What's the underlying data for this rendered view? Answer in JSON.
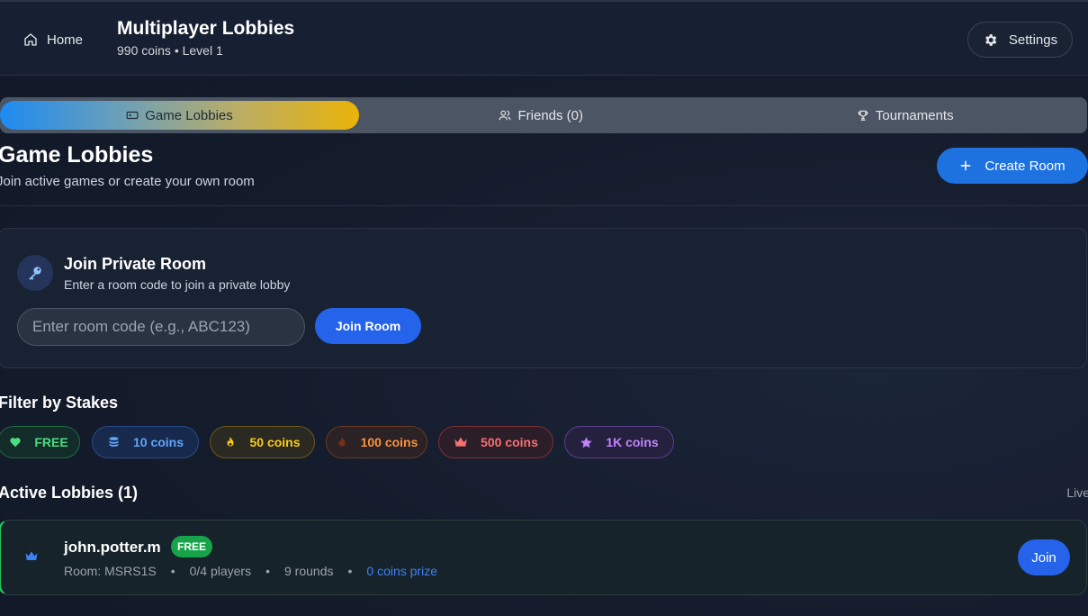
{
  "header": {
    "home_label": "Home",
    "title": "Multiplayer Lobbies",
    "subtitle": "990 coins • Level 1",
    "settings_label": "Settings"
  },
  "tabs": [
    {
      "label": "Game Lobbies",
      "icon": "gamepad-icon",
      "active": true
    },
    {
      "label": "Friends (0)",
      "icon": "users-icon",
      "active": false
    },
    {
      "label": "Tournaments",
      "icon": "trophy-icon",
      "active": false
    }
  ],
  "section": {
    "title": "Game Lobbies",
    "subtitle": "Join active games or create your own room",
    "create_label": "Create Room"
  },
  "private_room": {
    "title": "Join Private Room",
    "subtitle": "Enter a room code to join a private lobby",
    "input_placeholder": "Enter room code (e.g., ABC123)",
    "input_value": "",
    "join_label": "Join Room"
  },
  "filters": {
    "title": "Filter by Stakes",
    "chips": [
      {
        "label": "FREE",
        "icon": "heart-icon",
        "color": "#4ade80"
      },
      {
        "label": "10 coins",
        "icon": "coins-icon",
        "color": "#60a5fa"
      },
      {
        "label": "50 coins",
        "icon": "fire-icon",
        "color": "#facc15"
      },
      {
        "label": "100 coins",
        "icon": "flame-icon",
        "color": "#fb923c"
      },
      {
        "label": "500 coins",
        "icon": "crown-icon",
        "color": "#f87171"
      },
      {
        "label": "1K coins",
        "icon": "star-icon",
        "color": "#c084fc"
      }
    ]
  },
  "lobbies": {
    "title": "Active Lobbies (1)",
    "live_label": "Live",
    "items": [
      {
        "host": "john.potter.m",
        "badge": "FREE",
        "room": "Room: MSRS1S",
        "players": "0/4 players",
        "rounds": "9 rounds",
        "prize": "0 coins prize",
        "join_label": "Join"
      }
    ]
  },
  "colors": {
    "accent_blue": "#2563eb",
    "free_green": "#22c55e",
    "tab_gradient_start": "#1d8bf1",
    "tab_gradient_end": "#eab308"
  }
}
